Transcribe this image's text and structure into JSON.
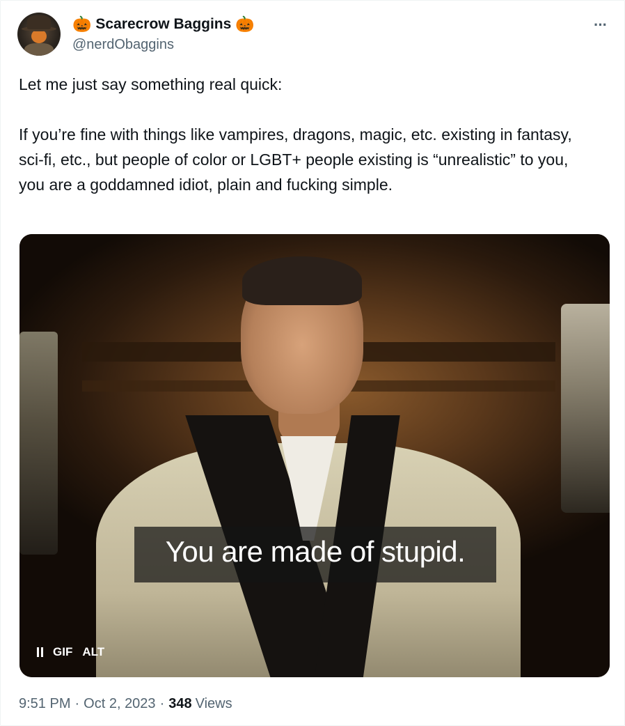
{
  "tweet": {
    "display_name": "Scarecrow Baggins",
    "name_emoji": "🎃",
    "handle": "@nerdObaggins",
    "paragraphs": [
      "Let me just say something real quick:",
      "If you’re fine with things like vampires, dragons, magic, etc. existing in fantasy, sci-fi, etc., but people of color or LGBT+ people existing is “unrealistic” to you, you are a goddamned idiot, plain and fucking simple."
    ],
    "more_label": "···",
    "media": {
      "caption": "You are made of stupid.",
      "gif_label": "GIF",
      "alt_label": "ALT"
    },
    "time": "9:51 PM",
    "date": "Oct 2, 2023",
    "separator": "·",
    "views_count": "348",
    "views_label": "Views"
  }
}
